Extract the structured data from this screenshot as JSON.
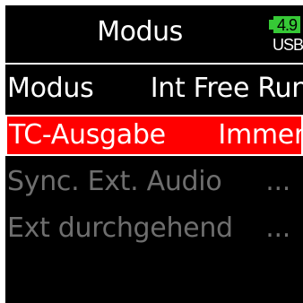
{
  "header": {
    "title": "Modus",
    "battery_level": "4.9",
    "battery_source": "USB"
  },
  "colors": {
    "background": "#000000",
    "text": "#ffffff",
    "selection": "#ff0000",
    "disabled_text": "#6e6e6e",
    "battery": "#36c936"
  },
  "menu": {
    "items": [
      {
        "label": "Modus",
        "value": "Int Free Run",
        "state": "normal"
      },
      {
        "label": "TC-Ausgabe",
        "value": "Immer",
        "state": "selected"
      },
      {
        "label": "Sync. Ext. Audio",
        "value": "...",
        "state": "disabled"
      },
      {
        "label": "Ext durchgehend",
        "value": "...",
        "state": "disabled"
      }
    ]
  }
}
